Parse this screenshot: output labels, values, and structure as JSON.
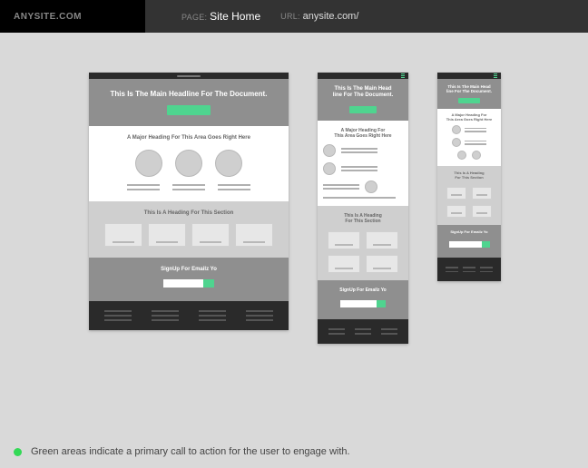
{
  "topbar": {
    "brand": "ANYSITE.COM",
    "page_label": "PAGE:",
    "page_value": "Site Home",
    "url_label": "URL:",
    "url_value": "anysite.com/"
  },
  "doc": {
    "headline": "This Is The Main Headline For The Document.",
    "headline_wrapped": "This Is The Main Head\nline For The Document.",
    "area_heading": "A Major Heading For This Area Goes Right Here",
    "area_heading_wrapped": "A Major Heading For\nThis Area Goes Right Here",
    "section_heading": "This Is A Heading For This Section",
    "section_heading_wrapped": "This Is A Heading\nFor This Section",
    "signup_heading": "SignUp For Emailz Yo"
  },
  "legend": {
    "text": "Green areas indicate a primary call to action for the user to engage with."
  },
  "colors": {
    "cta": "#4fd48f",
    "legend_dot": "#33d956"
  }
}
